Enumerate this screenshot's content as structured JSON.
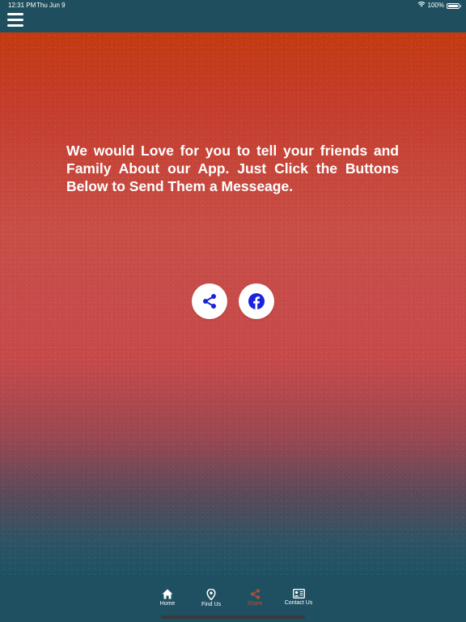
{
  "status_bar": {
    "time": "12:31 PM",
    "date": "Thu Jun 9",
    "battery": "100%",
    "battery_level": 1.0,
    "wifi_icon": "wifi-icon",
    "battery_icon": "battery-icon"
  },
  "header": {
    "menu_icon": "hamburger-menu-icon",
    "background": "#1f4f5e"
  },
  "main": {
    "message": "We would Love for you to tell your friends and Family About our App. Just Click the Buttons Below to Send Them a Messeage.",
    "buttons": [
      {
        "icon": "share-icon",
        "color": "#1a22e0"
      },
      {
        "icon": "facebook-icon",
        "color": "#1a22e0"
      }
    ]
  },
  "tab_bar": {
    "background": "#1f5062",
    "active_color": "#b8502e",
    "tabs": [
      {
        "label": "Home",
        "icon": "home-icon",
        "active": false
      },
      {
        "label": "Find Us",
        "icon": "map-pin-icon",
        "active": false
      },
      {
        "label": "Share",
        "icon": "share-icon",
        "active": true
      },
      {
        "label": "Contact Us",
        "icon": "contact-card-icon",
        "active": false
      }
    ]
  }
}
